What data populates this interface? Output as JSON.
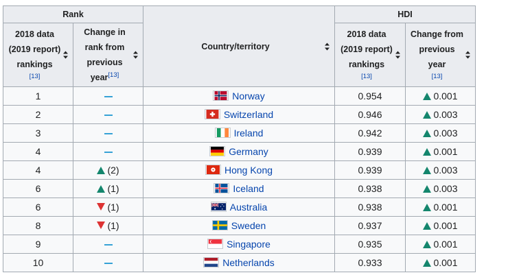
{
  "headers": {
    "rank_group": "Rank",
    "hdi_group": "HDI",
    "rank_data_line1": "2018 data",
    "rank_data_line2": "(2019 report)",
    "rank_data_line3": "rankings",
    "rank_data_ref": "[13]",
    "rank_change_line1": "Change in",
    "rank_change_line2": "rank from",
    "rank_change_line3": "previous",
    "rank_change_line4": "year",
    "rank_change_ref": "[13]",
    "country": "Country/territory",
    "hdi_data_line1": "2018 data",
    "hdi_data_line2": "(2019 report)",
    "hdi_data_line3": "rankings",
    "hdi_data_ref": "[13]",
    "hdi_change_line1": "Change from",
    "hdi_change_line2": "previous",
    "hdi_change_line3": "year",
    "hdi_change_ref": "[13]"
  },
  "icons": {
    "sort": "sort-icon",
    "up": "up-arrow-icon",
    "down": "down-arrow-icon",
    "same": "no-change-dash-icon"
  },
  "colors": {
    "up": "#14866d",
    "down": "#dd3333",
    "same": "#36a2d6",
    "link": "#0645ad"
  },
  "rows": [
    {
      "rank": "1",
      "change_dir": "same",
      "change_value": "",
      "country": "Norway",
      "flag": "norway-flag-icon",
      "hdi": "0.954",
      "hdi_change": "0.001"
    },
    {
      "rank": "2",
      "change_dir": "same",
      "change_value": "",
      "country": "Switzerland",
      "flag": "switzerland-flag-icon",
      "hdi": "0.946",
      "hdi_change": "0.003"
    },
    {
      "rank": "3",
      "change_dir": "same",
      "change_value": "",
      "country": "Ireland",
      "flag": "ireland-flag-icon",
      "hdi": "0.942",
      "hdi_change": "0.003"
    },
    {
      "rank": "4",
      "change_dir": "same",
      "change_value": "",
      "country": "Germany",
      "flag": "germany-flag-icon",
      "hdi": "0.939",
      "hdi_change": "0.001"
    },
    {
      "rank": "4",
      "change_dir": "up",
      "change_value": "(2)",
      "country": "Hong Kong",
      "flag": "hong-kong-flag-icon",
      "hdi": "0.939",
      "hdi_change": "0.003"
    },
    {
      "rank": "6",
      "change_dir": "up",
      "change_value": "(1)",
      "country": "Iceland",
      "flag": "iceland-flag-icon",
      "hdi": "0.938",
      "hdi_change": "0.003"
    },
    {
      "rank": "6",
      "change_dir": "down",
      "change_value": "(1)",
      "country": "Australia",
      "flag": "australia-flag-icon",
      "hdi": "0.938",
      "hdi_change": "0.001"
    },
    {
      "rank": "8",
      "change_dir": "down",
      "change_value": "(1)",
      "country": "Sweden",
      "flag": "sweden-flag-icon",
      "hdi": "0.937",
      "hdi_change": "0.001"
    },
    {
      "rank": "9",
      "change_dir": "same",
      "change_value": "",
      "country": "Singapore",
      "flag": "singapore-flag-icon",
      "hdi": "0.935",
      "hdi_change": "0.001"
    },
    {
      "rank": "10",
      "change_dir": "same",
      "change_value": "",
      "country": "Netherlands",
      "flag": "netherlands-flag-icon",
      "hdi": "0.933",
      "hdi_change": "0.001"
    }
  ]
}
